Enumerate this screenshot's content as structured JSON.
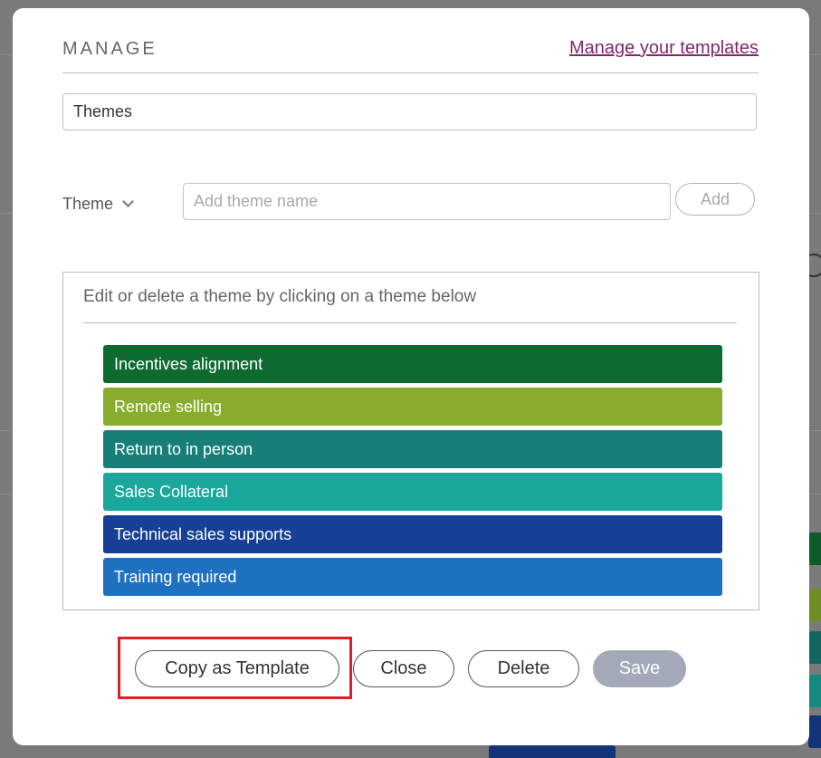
{
  "modal": {
    "title": "MANAGE",
    "manage_templates_link": "Manage your templates",
    "template_name_value": "Themes",
    "theme_selector_label": "Theme",
    "add_theme_placeholder": "Add theme name",
    "add_button_label": "Add",
    "themes_hint": "Edit or delete a theme by clicking on a theme below",
    "themes": [
      {
        "label": "Incentives alignment",
        "color": "#0d6b30"
      },
      {
        "label": "Remote selling",
        "color": "#88ad2e"
      },
      {
        "label": "Return to in person",
        "color": "#177f78"
      },
      {
        "label": "Sales Collateral",
        "color": "#1aa79c"
      },
      {
        "label": "Technical sales supports",
        "color": "#163f95"
      },
      {
        "label": "Training required",
        "color": "#1e70c0"
      }
    ],
    "buttons": {
      "copy_template": "Copy as Template",
      "close": "Close",
      "delete": "Delete",
      "save": "Save"
    }
  },
  "colors": {
    "link": "#7d2a6c",
    "save_disabled": "#a3a9b8",
    "highlight": "#e01f26"
  }
}
